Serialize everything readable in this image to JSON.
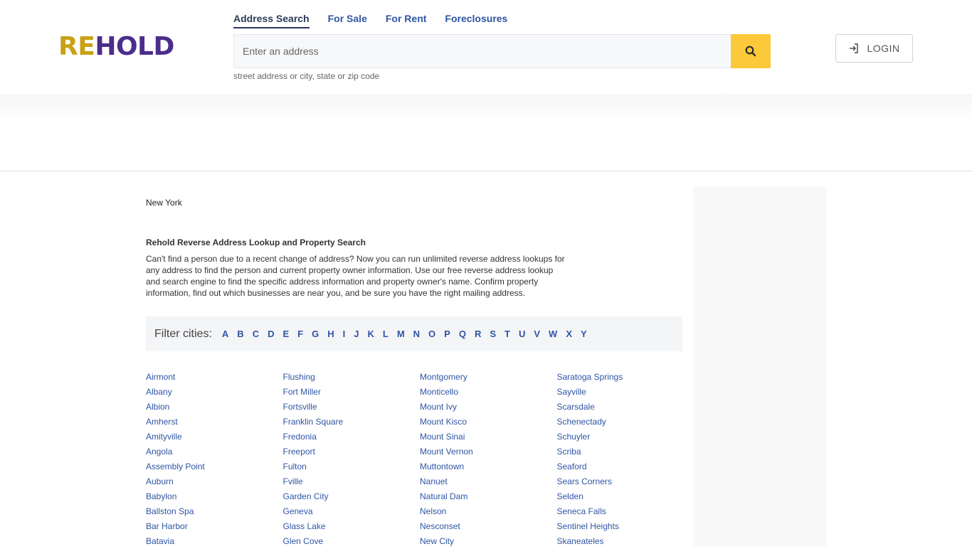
{
  "brand": {
    "logo_re": "RE",
    "logo_hold": "HOLD"
  },
  "nav": {
    "tabs": [
      {
        "label": "Address Search"
      },
      {
        "label": "For Sale"
      },
      {
        "label": "For Rent"
      },
      {
        "label": "Foreclosures"
      }
    ],
    "active_tab": "Address Search"
  },
  "search": {
    "placeholder": "Enter an address",
    "value": "",
    "hint": "street address or city, state or zip code",
    "button_icon": "search-icon"
  },
  "login": {
    "label": "LOGIN",
    "icon": "sign-in-icon"
  },
  "breadcrumb": "New York",
  "intro": {
    "title": "Rehold Reverse Address Lookup and Property Search",
    "text": "Can't find a person due to a recent change of address? Now you can run unlimited reverse address lookups for any address to find the person and current property owner information. Use our free reverse address lookup and search engine to find the specific address information and property owner's name. Confirm property information, find out which businesses are near you, and be sure you have the right mailing address."
  },
  "filter": {
    "label": "Filter cities:",
    "letters": [
      "A",
      "B",
      "C",
      "D",
      "E",
      "F",
      "G",
      "H",
      "I",
      "J",
      "K",
      "L",
      "M",
      "N",
      "O",
      "P",
      "Q",
      "R",
      "S",
      "T",
      "U",
      "V",
      "W",
      "X",
      "Y"
    ]
  },
  "cities": {
    "col1": [
      "Airmont",
      "Albany",
      "Albion",
      "Amherst",
      "Amityville",
      "Angola",
      "Assembly Point",
      "Auburn",
      "Babylon",
      "Ballston Spa",
      "Bar Harbor",
      "Batavia"
    ],
    "col2": [
      "Flushing",
      "Fort Miller",
      "Fortsville",
      "Franklin Square",
      "Fredonia",
      "Freeport",
      "Fulton",
      "Fville",
      "Garden City",
      "Geneva",
      "Glass Lake",
      "Glen Cove"
    ],
    "col3": [
      "Montgomery",
      "Monticello",
      "Mount Ivy",
      "Mount Kisco",
      "Mount Sinai",
      "Mount Vernon",
      "Muttontown",
      "Nanuet",
      "Natural Dam",
      "Nelson",
      "Nesconset",
      "New City"
    ],
    "col4": [
      "Saratoga Springs",
      "Sayville",
      "Scarsdale",
      "Schenectady",
      "Schuyler",
      "Scriba",
      "Seaford",
      "Sears Corners",
      "Selden",
      "Seneca Falls",
      "Sentinel Heights",
      "Skaneateles"
    ]
  },
  "colors": {
    "logo_gold": "#c9a115",
    "logo_purple": "#4b2d8c",
    "link_blue": "#2f55a4",
    "search_button": "#fbc93a"
  }
}
